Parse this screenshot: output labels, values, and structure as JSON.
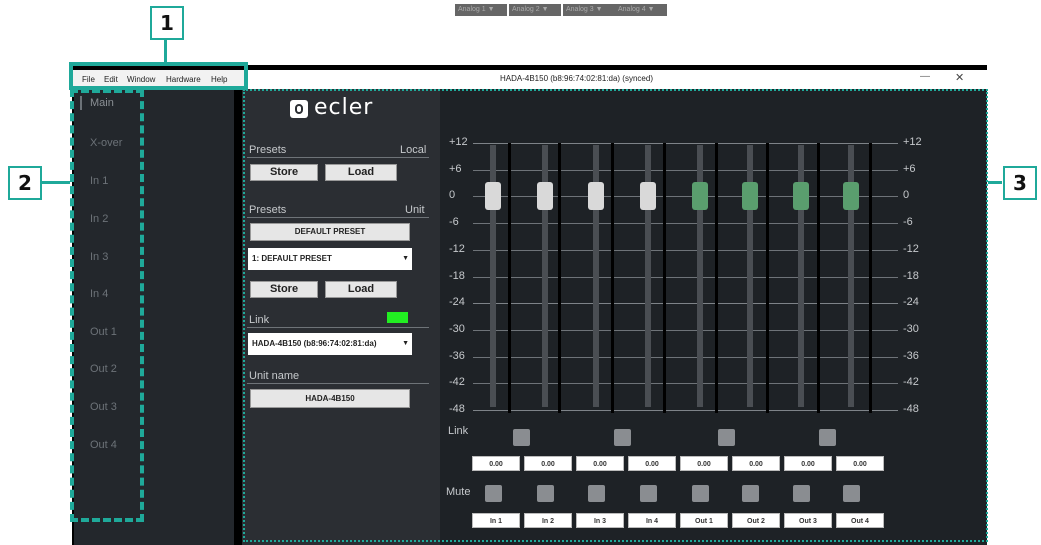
{
  "callouts": [
    "1",
    "2",
    "3"
  ],
  "menu": [
    "File",
    "Edit",
    "Window",
    "Hardware",
    "Help"
  ],
  "window": {
    "title": "HADA-4B150 (b8:96:74:02:81:da) (synced)",
    "minimize": "—",
    "close": "✕"
  },
  "sidebar": {
    "items": [
      "Main",
      "X-over",
      "In 1",
      "In 2",
      "In 3",
      "In 4",
      "Out 1",
      "Out 2",
      "Out 3",
      "Out 4"
    ],
    "active": "Main"
  },
  "brand": {
    "logo_text": "ecler"
  },
  "left": {
    "presets_local_label": "Presets",
    "presets_local_right": "Local",
    "store1": "Store",
    "load1": "Load",
    "presets_unit_label": "Presets",
    "presets_unit_right": "Unit",
    "default_preset_button": "DEFAULT PRESET",
    "preset_select": "1: DEFAULT PRESET",
    "store2": "Store",
    "load2": "Load",
    "link_label": "Link",
    "link_indicator_color": "#22ee22",
    "link_select": "HADA-4B150 (b8:96:74:02:81:da)",
    "unit_name_label": "Unit name",
    "unit_name_value": "HADA-4B150"
  },
  "mixer": {
    "input_tabs": [
      "Analog 1",
      "Analog 2",
      "Analog 3",
      "Analog 4"
    ],
    "scale": [
      "+12",
      "+6",
      "0",
      "-6",
      "-12",
      "-18",
      "-24",
      "-30",
      "-36",
      "-42",
      "-48"
    ],
    "link_label": "Link",
    "mute_label": "Mute",
    "channels": [
      {
        "name": "In 1",
        "value": "0.00",
        "level_db": 0,
        "knob_color": "#d9d9d9"
      },
      {
        "name": "In 2",
        "value": "0.00",
        "level_db": 0,
        "knob_color": "#d9d9d9"
      },
      {
        "name": "In 3",
        "value": "0.00",
        "level_db": 0,
        "knob_color": "#d9d9d9"
      },
      {
        "name": "In 4",
        "value": "0.00",
        "level_db": 0,
        "knob_color": "#d9d9d9"
      },
      {
        "name": "Out 1",
        "value": "0.00",
        "level_db": 0,
        "knob_color": "#5a9e6e"
      },
      {
        "name": "Out 2",
        "value": "0.00",
        "level_db": 0,
        "knob_color": "#5a9e6e"
      },
      {
        "name": "Out 3",
        "value": "0.00",
        "level_db": 0,
        "knob_color": "#5a9e6e"
      },
      {
        "name": "Out 4",
        "value": "0.00",
        "level_db": 0,
        "knob_color": "#5a9e6e"
      }
    ]
  },
  "colors": {
    "accent": "#1fa99a",
    "sidebar_bg": "#23272c",
    "panel_bg": "#2b2e33",
    "mixer_bg": "#1e2226"
  }
}
